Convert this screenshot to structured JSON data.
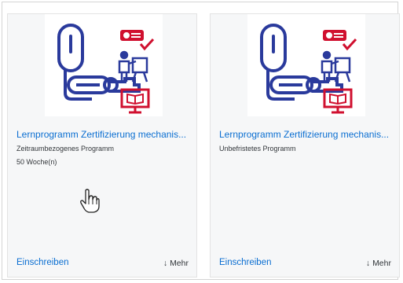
{
  "cards": [
    {
      "title": "Lernprogramm Zertifizierung mechanis...",
      "type": "Zeitraumbezogenes Programm",
      "duration": "50 Woche(n)",
      "enroll_label": "Einschreiben",
      "more_label": "Mehr",
      "more_icon": "arrow-down-icon"
    },
    {
      "title": "Lernprogramm Zertifizierung mechanis...",
      "type": "Unbefristetes Programm",
      "enroll_label": "Einschreiben",
      "more_label": "Mehr",
      "more_icon": "arrow-down-icon"
    }
  ],
  "colors": {
    "link": "#0a6ed1",
    "icon_blue": "#2a3a9c",
    "icon_red": "#d0102f",
    "card_bg": "#f6f7f8"
  },
  "cursor_icon": "hand-pointer-icon"
}
